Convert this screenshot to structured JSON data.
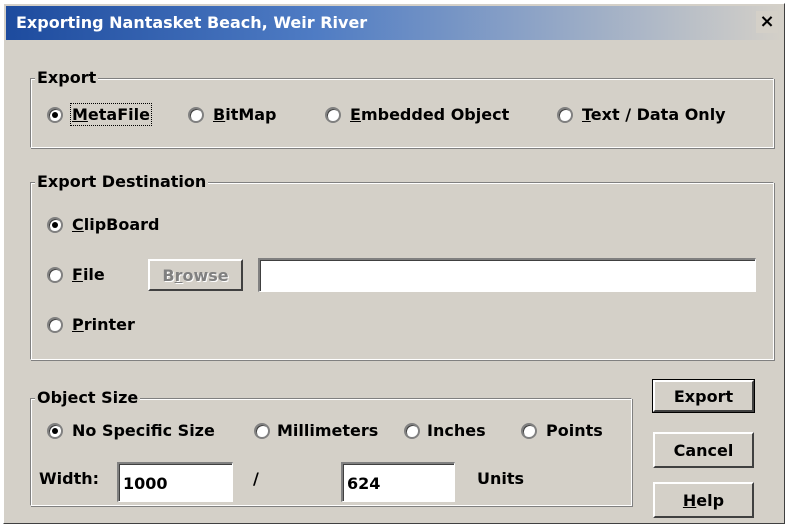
{
  "window": {
    "title": "Exporting Nantasket Beach, Weir River",
    "close_glyph": "×"
  },
  "export_group": {
    "label": "Export",
    "options": [
      {
        "key": "M",
        "rest": "etaFile",
        "checked": true
      },
      {
        "key": "B",
        "rest": "itMap",
        "checked": false
      },
      {
        "key": "E",
        "rest": "mbedded Object",
        "checked": false
      },
      {
        "key": "T",
        "rest": "ext / Data Only",
        "checked": false
      }
    ]
  },
  "destination_group": {
    "label": "Export Destination",
    "clipboard": {
      "key": "C",
      "rest": "lipBoard",
      "checked": true
    },
    "file": {
      "key": "F",
      "rest": "ile",
      "checked": false
    },
    "browse_button": {
      "pre": "B",
      "key": "r",
      "rest": "owse",
      "enabled": false
    },
    "file_path": "",
    "printer": {
      "key": "P",
      "rest": "rinter",
      "checked": false
    }
  },
  "size_group": {
    "label": "Object Size",
    "options": [
      "No Specific Size",
      "Millimeters",
      "Inches",
      "Points"
    ],
    "selected": "No Specific Size",
    "width_label": "Width:",
    "width_value": "1000",
    "separator": "/",
    "height_value": "624",
    "units_label": "Units"
  },
  "buttons": {
    "export": "Export",
    "cancel": "Cancel",
    "help_key": "H",
    "help_rest": "elp"
  }
}
